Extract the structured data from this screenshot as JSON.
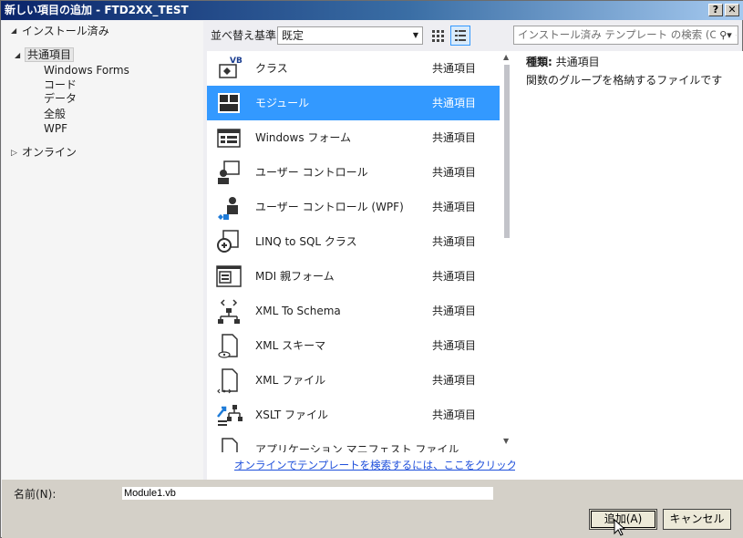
{
  "window": {
    "title": "新しい項目の追加 - FTD2XX_TEST",
    "help_btn": "?",
    "close_btn": "✕"
  },
  "tree": {
    "installed": "インストール済み",
    "common": "共通項目",
    "children": [
      "Windows Forms",
      "コード",
      "データ",
      "全般",
      "WPF"
    ],
    "online": "オンライン"
  },
  "toolbar": {
    "sort_label": "並べ替え基準:",
    "sort_value": "既定",
    "search_placeholder": "インストール済み テンプレート の検索 (Ctrl+"
  },
  "items": [
    {
      "name": "クラス",
      "category": "共通項目",
      "icon": "vb-class-icon"
    },
    {
      "name": "モジュール",
      "category": "共通項目",
      "icon": "module-icon",
      "selected": true
    },
    {
      "name": "Windows フォーム",
      "category": "共通項目",
      "icon": "form-icon"
    },
    {
      "name": "ユーザー コントロール",
      "category": "共通項目",
      "icon": "user-control-icon"
    },
    {
      "name": "ユーザー コントロール (WPF)",
      "category": "共通項目",
      "icon": "wpf-user-control-icon"
    },
    {
      "name": "LINQ to SQL クラス",
      "category": "共通項目",
      "icon": "linq-icon"
    },
    {
      "name": "MDI 親フォーム",
      "category": "共通項目",
      "icon": "mdi-form-icon"
    },
    {
      "name": "XML To Schema",
      "category": "共通項目",
      "icon": "xml-schema-icon"
    },
    {
      "name": "XML スキーマ",
      "category": "共通項目",
      "icon": "xsd-icon"
    },
    {
      "name": "XML ファイル",
      "category": "共通項目",
      "icon": "xml-file-icon"
    },
    {
      "name": "XSLT ファイル",
      "category": "共通項目",
      "icon": "xslt-icon"
    },
    {
      "name": "アプリケーション マニフェスト ファイル",
      "category": "",
      "icon": "manifest-icon"
    }
  ],
  "online_link": "オンラインでテンプレートを検索するには、ここをクリックします。",
  "details": {
    "type_label": "種類:",
    "type_value": "共通項目",
    "description": "関数のグループを格納するファイルです"
  },
  "name_field": {
    "label": "名前(N):",
    "value": "Module1.vb"
  },
  "buttons": {
    "add": "追加(A)",
    "cancel": "キャンセル"
  },
  "colors": {
    "selection": "#3399ff",
    "link": "#1e4fdb"
  }
}
